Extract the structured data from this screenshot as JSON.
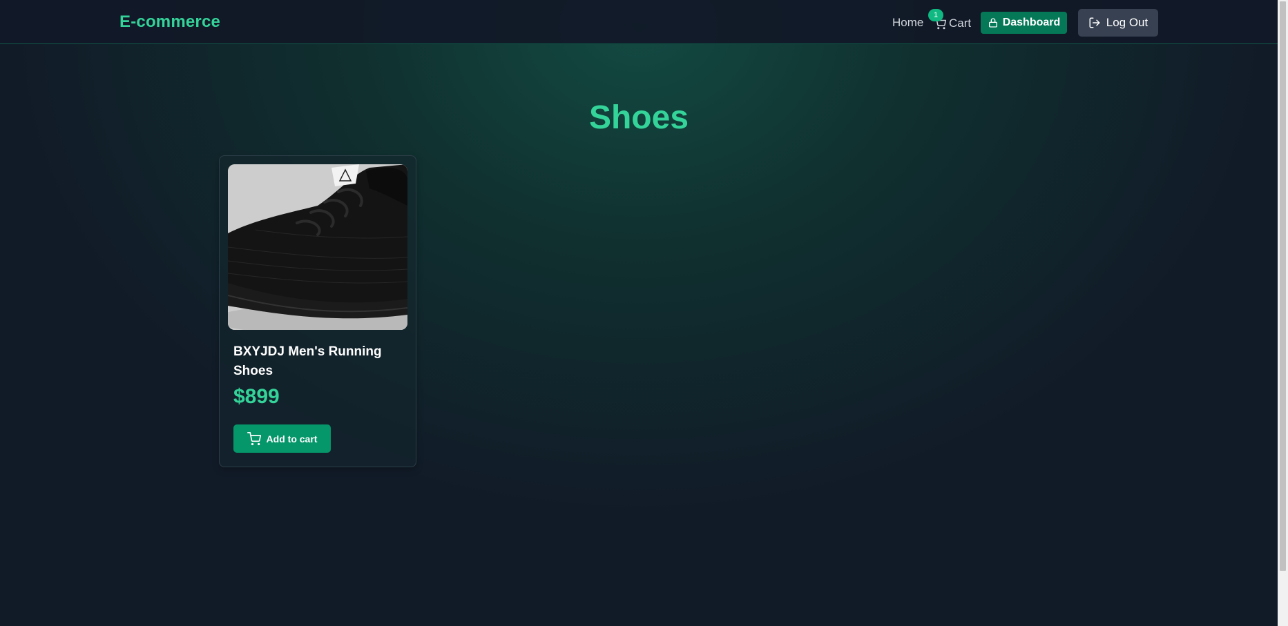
{
  "navbar": {
    "brand": "E-commerce",
    "home_label": "Home",
    "cart_label": "Cart",
    "cart_count": "1",
    "dashboard_label": "Dashboard",
    "logout_label": "Log Out"
  },
  "page": {
    "title": "Shoes"
  },
  "products": [
    {
      "name": "BXYJDJ Men's Running Shoes",
      "price": "$899",
      "add_label": "Add to cart"
    }
  ],
  "colors": {
    "accent": "#34d399",
    "button": "#059669",
    "dashboard": "#047857",
    "logout": "#374151",
    "background": "#111827"
  }
}
